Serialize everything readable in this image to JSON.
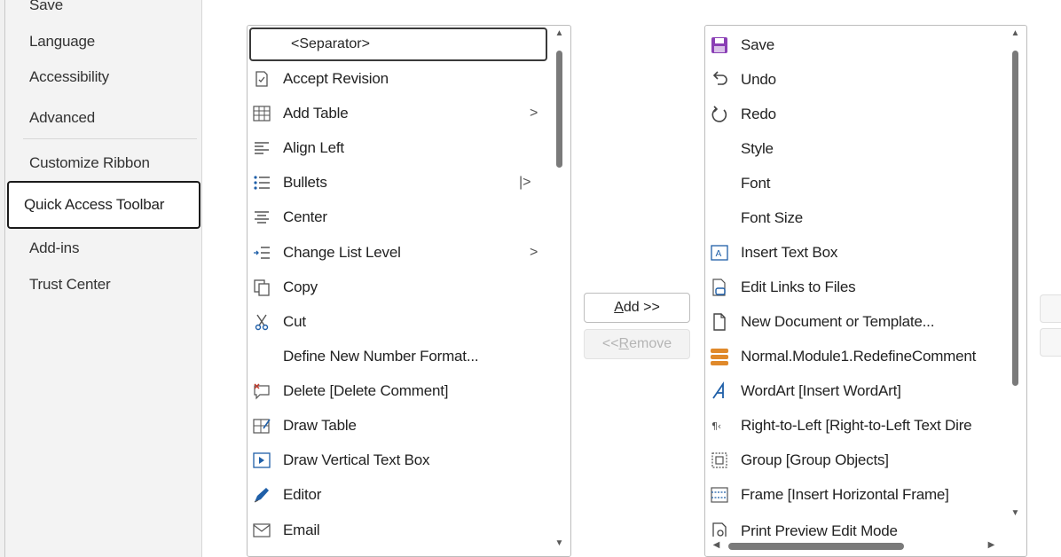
{
  "nav": {
    "items": [
      "Save",
      "Language",
      "Accessibility",
      "Advanced",
      "Customize Ribbon",
      "Quick Access Toolbar",
      "Add-ins",
      "Trust Center"
    ],
    "selected": "Quick Access Toolbar"
  },
  "commands": {
    "separator_label": "<Separator>",
    "items": [
      {
        "label": "Accept Revision",
        "icon": "accept-revision-icon"
      },
      {
        "label": "Add Table",
        "icon": "table-icon",
        "submenu": ">"
      },
      {
        "label": "Align Left",
        "icon": "align-left-icon"
      },
      {
        "label": "Bullets",
        "icon": "bullets-icon",
        "submenu": "|>"
      },
      {
        "label": "Center",
        "icon": "align-center-icon"
      },
      {
        "label": "Change List Level",
        "icon": "list-level-icon",
        "submenu": ">"
      },
      {
        "label": "Copy",
        "icon": "copy-icon"
      },
      {
        "label": "Cut",
        "icon": "scissors-icon"
      },
      {
        "label": "Define New Number Format...",
        "icon": ""
      },
      {
        "label": "Delete [Delete Comment]",
        "icon": "delete-comment-icon"
      },
      {
        "label": "Draw Table",
        "icon": "draw-table-icon"
      },
      {
        "label": "Draw Vertical Text Box",
        "icon": "vertical-textbox-icon"
      },
      {
        "label": "Editor",
        "icon": "editor-icon"
      },
      {
        "label": "Email",
        "icon": "email-icon"
      }
    ]
  },
  "buttons": {
    "add": "Add >>",
    "add_key": "A",
    "add_rest": "dd >>",
    "remove_pre": "<< ",
    "remove_key": "R",
    "remove_rest": "emove"
  },
  "toolbar": {
    "items": [
      {
        "label": "Save",
        "icon": "save-icon"
      },
      {
        "label": "Undo",
        "icon": "undo-icon"
      },
      {
        "label": "Redo",
        "icon": "redo-icon"
      },
      {
        "label": "Style",
        "icon": ""
      },
      {
        "label": "Font",
        "icon": ""
      },
      {
        "label": "Font Size",
        "icon": ""
      },
      {
        "label": "Insert Text Box",
        "icon": "textbox-icon"
      },
      {
        "label": "Edit Links to Files",
        "icon": "edit-links-icon"
      },
      {
        "label": "New Document or Template...",
        "icon": "new-document-icon"
      },
      {
        "label": "Normal.Module1.RedefineComment",
        "icon": "macro-icon"
      },
      {
        "label": "WordArt [Insert WordArt]",
        "icon": "wordart-icon"
      },
      {
        "label": "Right-to-Left [Right-to-Left Text Dire",
        "icon": "rtl-icon"
      },
      {
        "label": "Group [Group Objects]",
        "icon": "group-icon"
      },
      {
        "label": "Frame [Insert Horizontal Frame]",
        "icon": "frame-icon"
      },
      {
        "label": "Print Preview Edit Mode",
        "icon": "print-preview-icon"
      }
    ]
  },
  "colors": {
    "accent_purple": "#8a3fb5",
    "icon_blue": "#1f5fa8",
    "macro_orange": "#e0892a",
    "scroll_thumb": "#7a7a7a"
  }
}
